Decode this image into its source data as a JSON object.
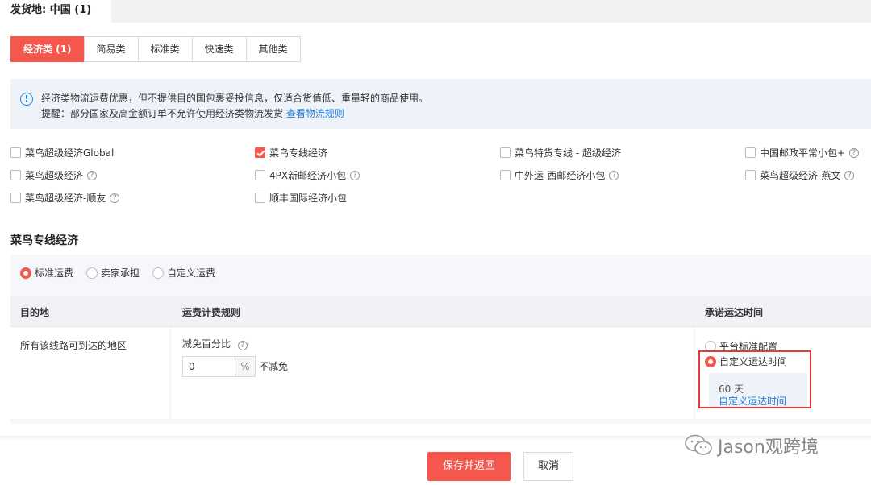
{
  "origin": {
    "label": "发货地:",
    "value": "中国 (1)"
  },
  "tabs": [
    {
      "label": "经济类 (1)"
    },
    {
      "label": "简易类"
    },
    {
      "label": "标准类"
    },
    {
      "label": "快速类"
    },
    {
      "label": "其他类"
    }
  ],
  "notice": {
    "line1": "经济类物流运费优惠，但不提供目的国包裹妥投信息，仅适合货值低、重量轻的商品使用。",
    "line2_prefix": "提醒：部分国家及高金额订单不允许使用经济类物流发货",
    "line2_link": "查看物流规则"
  },
  "carriers": [
    {
      "label": "菜鸟超级经济Global",
      "checked": false,
      "help": false
    },
    {
      "label": "菜鸟专线经济",
      "checked": true,
      "help": false
    },
    {
      "label": "菜鸟特货专线 - 超级经济",
      "checked": false,
      "help": false
    },
    {
      "label": "中国邮政平常小包+",
      "checked": false,
      "help": true
    },
    {
      "label": "菜鸟超级经济",
      "checked": false,
      "help": true
    },
    {
      "label": "4PX新邮经济小包",
      "checked": false,
      "help": true
    },
    {
      "label": "中外运-西邮经济小包",
      "checked": false,
      "help": true
    },
    {
      "label": "菜鸟超级经济-燕文",
      "checked": false,
      "help": true
    },
    {
      "label": "菜鸟超级经济-顺友",
      "checked": false,
      "help": true
    },
    {
      "label": "顺丰国际经济小包",
      "checked": false,
      "help": false
    }
  ],
  "section_title": "菜鸟专线经济",
  "fee_modes": [
    {
      "label": "标准运费",
      "selected": true
    },
    {
      "label": "卖家承担",
      "selected": false
    },
    {
      "label": "自定义运费",
      "selected": false
    }
  ],
  "table": {
    "headers": {
      "destination": "目的地",
      "rule": "运费计费规则",
      "time": "承诺运达时间"
    },
    "row": {
      "destination": "所有该线路可到达的地区",
      "discount_label": "减免百分比",
      "discount_value": "0",
      "discount_unit": "%",
      "discount_note": "不减免",
      "time_options": [
        {
          "label": "平台标准配置",
          "selected": false
        },
        {
          "label": "自定义运达时间",
          "selected": true
        }
      ],
      "days": "60 天",
      "custom_link": "自定义运达时间"
    }
  },
  "buttons": {
    "save": "保存并返回",
    "cancel": "取消"
  },
  "watermark": "Jason观跨境",
  "colors": {
    "accent": "#f5574c",
    "link": "#1e7fd6",
    "highlight": "#e53935"
  }
}
